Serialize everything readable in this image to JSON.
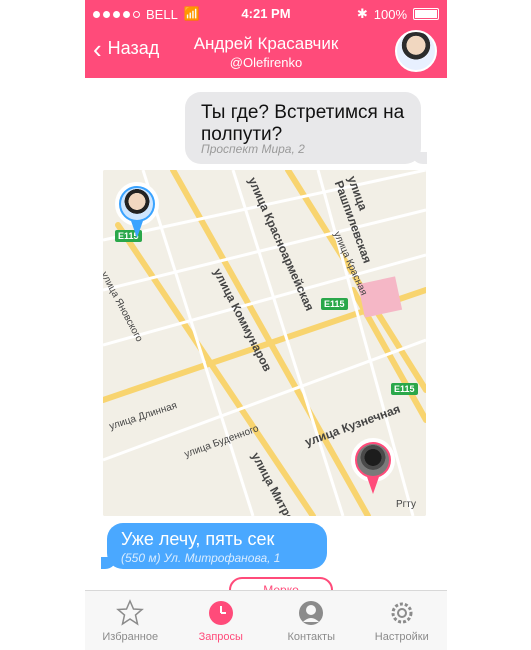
{
  "status_bar": {
    "carrier": "BELL",
    "time": "4:21 PM",
    "battery": "100%"
  },
  "header": {
    "back_label": "Назад",
    "title": "Андрей Красавчик",
    "subtitle": "@Olefirenko"
  },
  "messages": [
    {
      "text": "Ты где? Встретимся на полпути?",
      "address": "Проспект Мира, 2"
    },
    {
      "text": "Уже лечу, пять сек",
      "address": "(550 м) Ул. Митрофанова, 1"
    }
  ],
  "map": {
    "labels": [
      "улица Красноармейская",
      "улица Коммунаров",
      "улица Рашпилевская",
      "улица Красная",
      "улица Длинная",
      "улица Буденного",
      "улица Кузнечная",
      "улица Митрофанова",
      "улица Яновского"
    ],
    "shields": [
      "E115",
      "E115",
      "E115"
    ],
    "provider": "Ргту"
  },
  "more_button": "Мерко",
  "tabs": [
    {
      "label": "Избранное"
    },
    {
      "label": "Запросы"
    },
    {
      "label": "Контакты"
    },
    {
      "label": "Настройки"
    }
  ],
  "colors": {
    "accent": "#ff4b7a",
    "blue": "#4aa8ff"
  }
}
